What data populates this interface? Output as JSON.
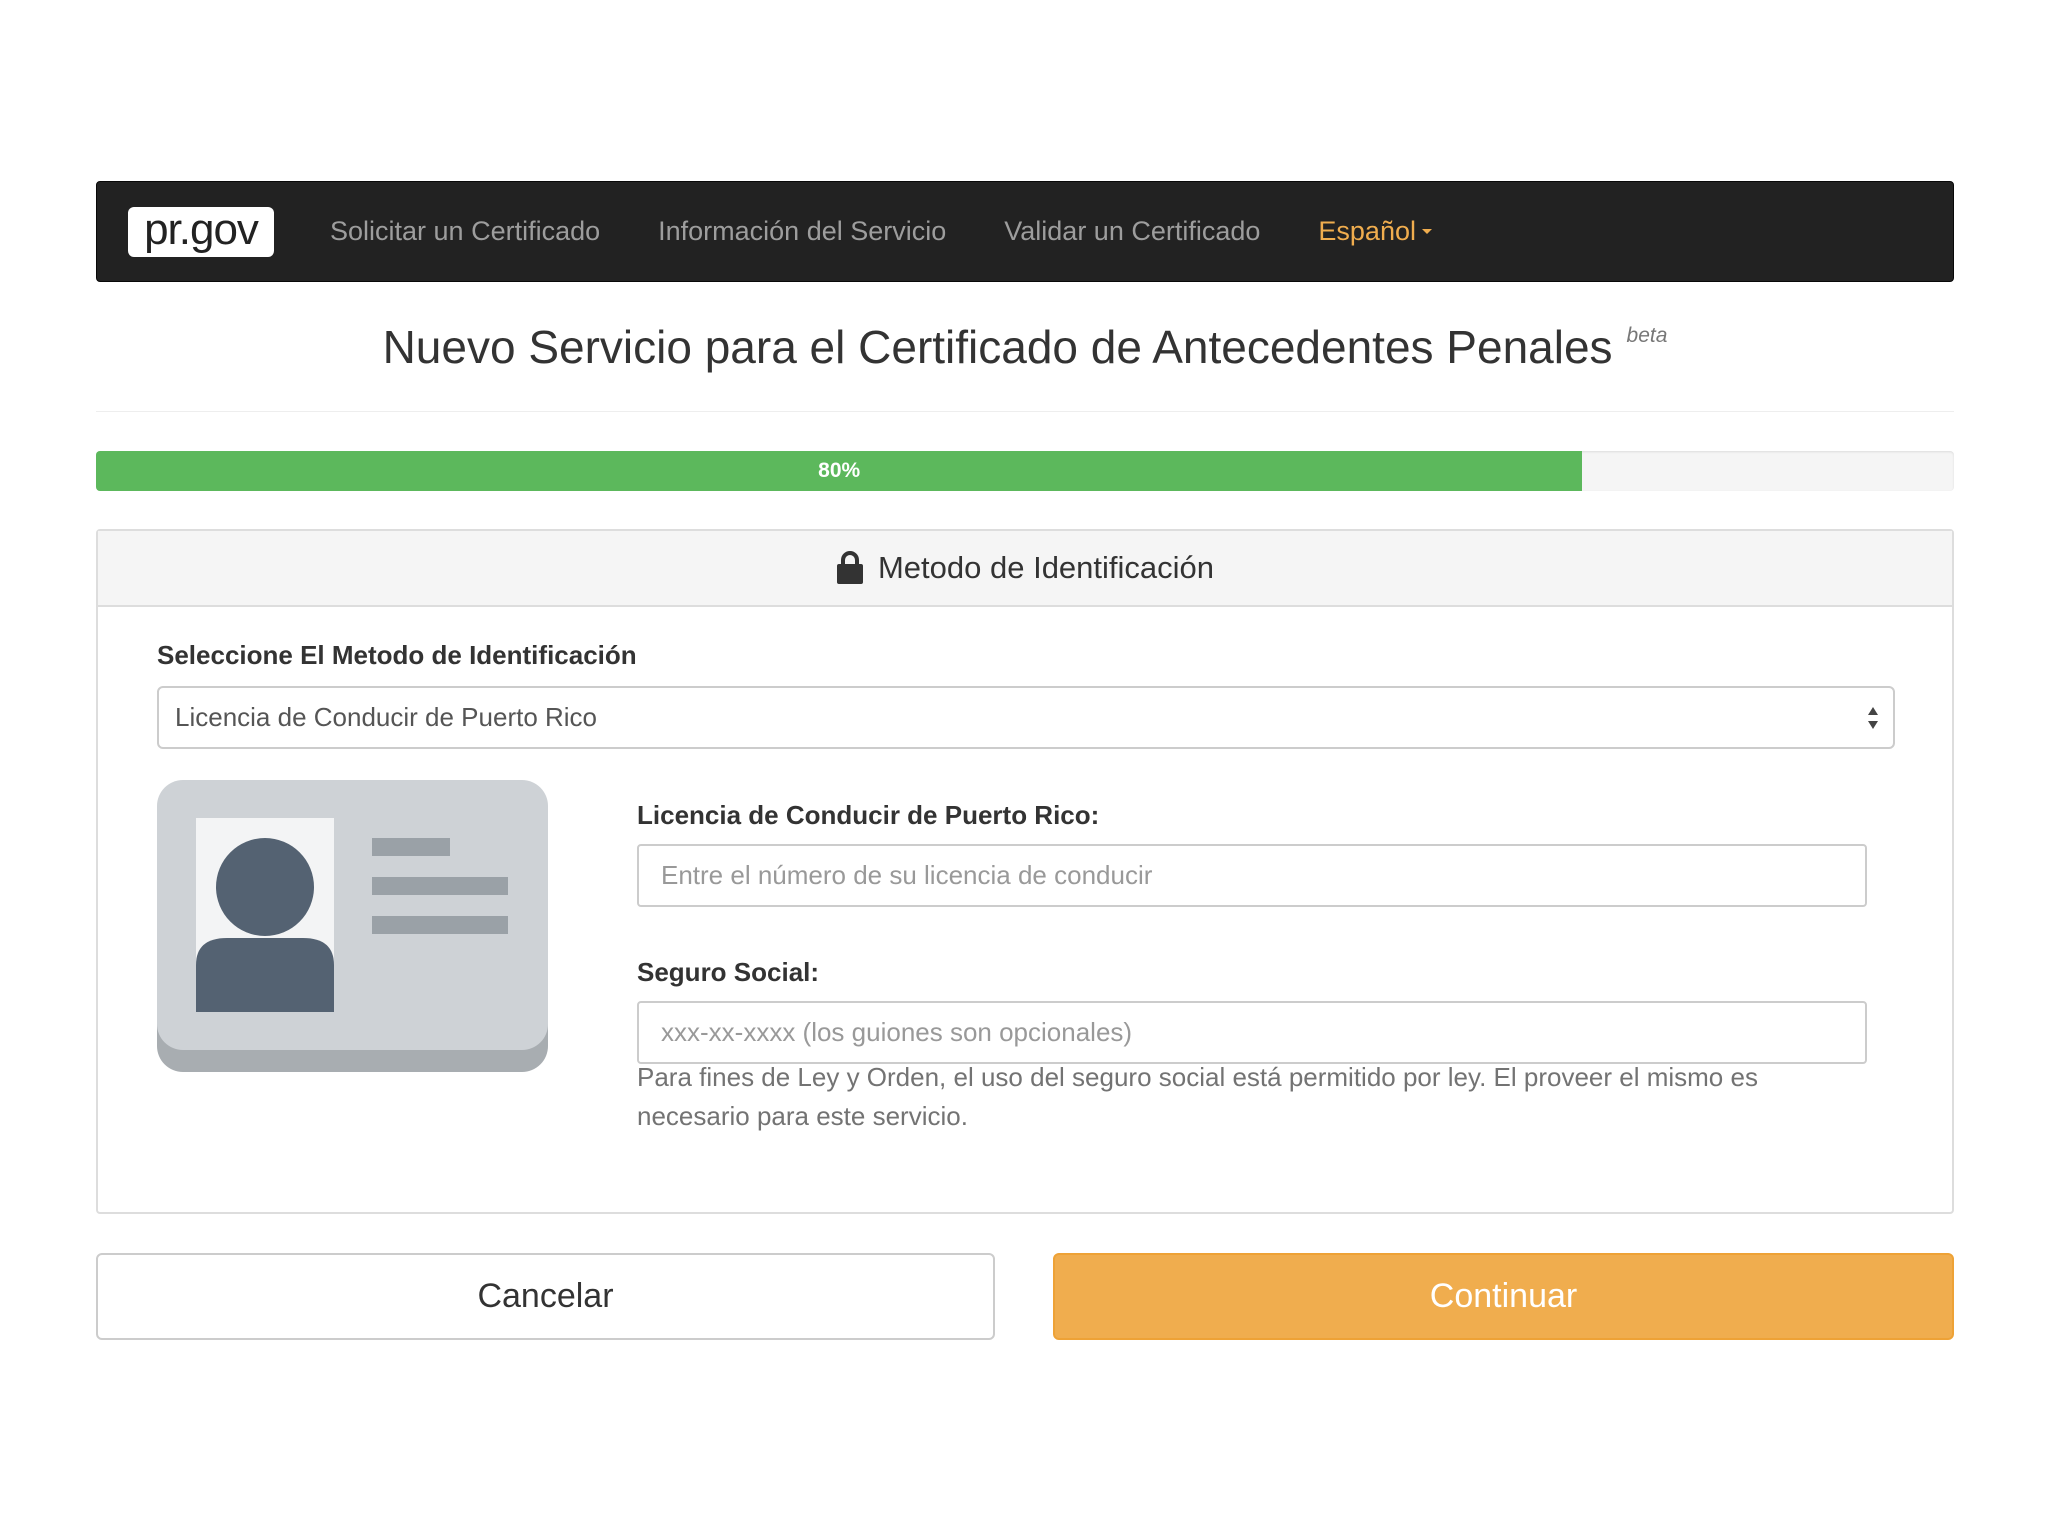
{
  "navbar": {
    "brand": "pr.gov",
    "links": [
      "Solicitar un Certificado",
      "Información del Servicio",
      "Validar un Certificado"
    ],
    "language": "Español"
  },
  "header": {
    "title": "Nuevo Servicio para el Certificado de Antecedentes Penales",
    "badge": "beta"
  },
  "progress": {
    "percent": 80,
    "label": "80%"
  },
  "panel": {
    "heading": "Metodo de Identificación",
    "select_label": "Seleccione El Metodo de Identificación",
    "select_value": "Licencia de Conducir de Puerto Rico",
    "license": {
      "label": "Licencia de Conducir de Puerto Rico:",
      "placeholder": "Entre el número de su licencia de conducir"
    },
    "ssn": {
      "label": "Seguro Social:",
      "placeholder": "xxx-xx-xxxx (los guiones son opcionales)"
    },
    "help_text": "Para fines de Ley y Orden, el uso del seguro social está permitido por ley. El proveer el mismo es necesario para este servicio."
  },
  "buttons": {
    "cancel": "Cancelar",
    "continue": "Continuar"
  },
  "colors": {
    "navbar": "#222222",
    "nav_link": "#9d9d9d",
    "accent": "#f0ad4e",
    "success": "#5cb85c"
  }
}
